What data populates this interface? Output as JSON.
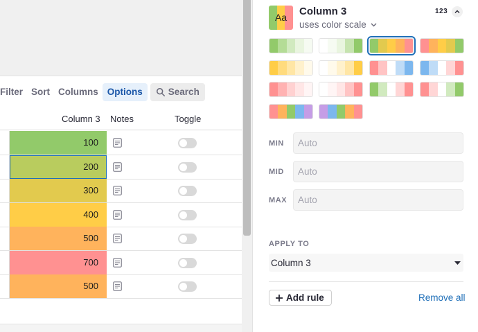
{
  "toolbar": {
    "filter": "Filter",
    "sort": "Sort",
    "columns": "Columns",
    "options": "Options",
    "search": "Search"
  },
  "grid": {
    "headers": {
      "col3": "Column 3",
      "notes": "Notes",
      "toggle": "Toggle"
    },
    "rows": [
      {
        "value": "100",
        "color": "#92ca6a"
      },
      {
        "value": "200",
        "color": "#b9cc5e",
        "selected": true
      },
      {
        "value": "300",
        "color": "#e2ca4e"
      },
      {
        "value": "400",
        "color": "#ffcd47"
      },
      {
        "value": "500",
        "color": "#ffb35c"
      },
      {
        "value": "700",
        "color": "#ff9191"
      },
      {
        "value": "500",
        "color": "#ffb35c"
      }
    ]
  },
  "panel": {
    "sample_text": "Aa",
    "title": "Column 3",
    "mode": "uses color scale",
    "num_type": "123",
    "min_label": "MIN",
    "mid_label": "MID",
    "max_label": "MAX",
    "min_placeholder": "Auto",
    "mid_placeholder": "Auto",
    "max_placeholder": "Auto",
    "apply_to_label": "APPLY TO",
    "apply_to_value": "Column 3",
    "add_rule": "Add rule",
    "remove_all": "Remove all"
  },
  "palettes": [
    [
      "#92ca6a",
      "#b4dc96",
      "#d1eabf",
      "#e9f5df",
      "#f6fbf2"
    ],
    [
      "#ffffff",
      "#f6fbf2",
      "#e9f5df",
      "#c6e4af",
      "#92ca6a"
    ],
    [
      "#92ca6a",
      "#e2ca4e",
      "#ffcd47",
      "#ffb35c",
      "#ff9191"
    ],
    [
      "#ff9191",
      "#ffb35c",
      "#ffcd47",
      "#e2ca4e",
      "#92ca6a"
    ],
    [
      "#ffcd47",
      "#ffdb7e",
      "#ffe6a5",
      "#fff1cc",
      "#fffaeb"
    ],
    [
      "#ffffff",
      "#fffaeb",
      "#fff1cc",
      "#ffe6a5",
      "#ffcd47"
    ],
    [
      "#ff9191",
      "#ffc4c4",
      "#ffffff",
      "#bfdcf7",
      "#7cb7ee"
    ],
    [
      "#7cb7ee",
      "#bfdcf7",
      "#ffffff",
      "#ffd6d6",
      "#ff9191"
    ],
    [
      "#ff9191",
      "#ffb2b2",
      "#ffd1d1",
      "#ffe6e6",
      "#fff5f5"
    ],
    [
      "#ffffff",
      "#fff5f5",
      "#ffe6e6",
      "#ffc4c4",
      "#ff9191"
    ],
    [
      "#92ca6a",
      "#d1eabf",
      "#ffffff",
      "#ffd6d6",
      "#ff9191"
    ],
    [
      "#ff9191",
      "#ffd6d6",
      "#ffffff",
      "#d1eabf",
      "#92ca6a"
    ],
    [
      "#ff9191",
      "#ffb35c",
      "#92ca6a",
      "#7cb7ee",
      "#c59de6"
    ],
    [
      "#c59de6",
      "#7cb7ee",
      "#92ca6a",
      "#ffb35c",
      "#ff9191"
    ]
  ],
  "selected_palette": 2,
  "colors": {
    "accent": "#1f6fb8",
    "active_tab_bg": "#e6f0fb"
  }
}
